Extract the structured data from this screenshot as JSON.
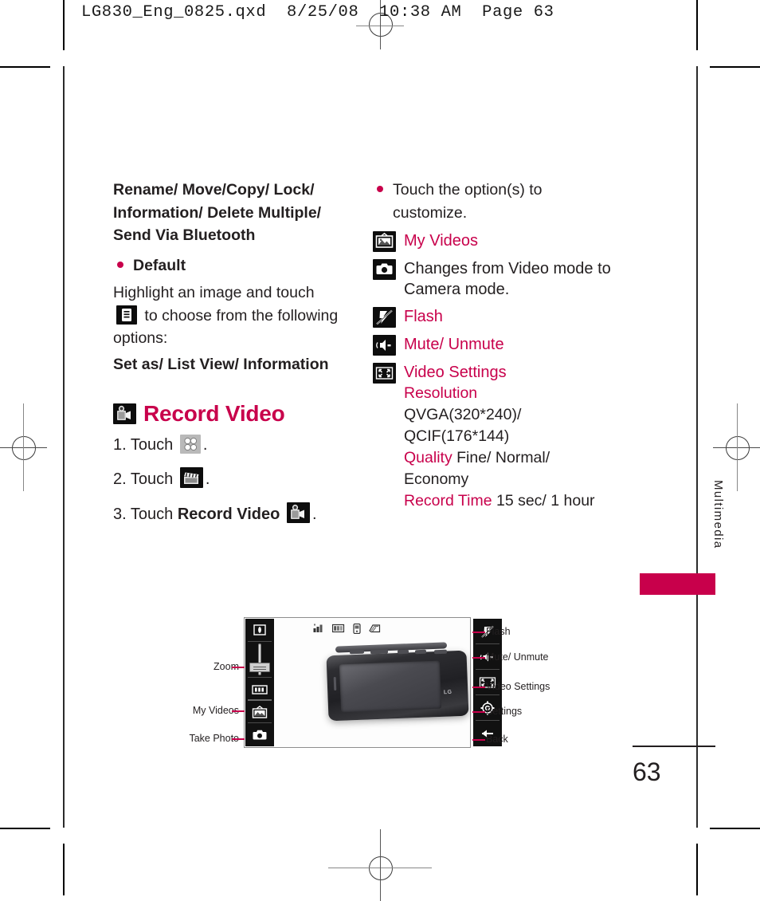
{
  "page": {
    "slug": "LG830_Eng_0825.qxd  8/25/08  10:38 AM  Page 63",
    "folio": "63",
    "section_tab": "Multimedia",
    "accent_color": "#c8004b"
  },
  "left_column": {
    "options_list": "Rename/ Move/Copy/ Lock/ Information/ Delete Multiple/ Send Via Bluetooth",
    "default_bullet": "Default",
    "instruction_part1": "Highlight an image and touch",
    "instruction_part2": "to choose from the following options:",
    "options_result": "Set as/ List View/ Information",
    "heading": "Record Video",
    "steps": [
      {
        "number": "1. Touch",
        "icon": "grid-icon",
        "suffix": "."
      },
      {
        "number": "2. Touch",
        "icon": "clapperboard-icon",
        "suffix": "."
      },
      {
        "number": "3. Touch",
        "bold": "Record Video",
        "icon": "camcorder-icon",
        "suffix": "."
      }
    ]
  },
  "right_column": {
    "bullet": "Touch the option(s) to customize.",
    "options": [
      {
        "icon": "my-videos-icon",
        "label": "My Videos",
        "color": "magenta"
      },
      {
        "icon": "camera-icon",
        "label": "Changes from Video mode to Camera mode.",
        "color": "black"
      },
      {
        "icon": "flash-icon",
        "label": "Flash",
        "color": "magenta"
      },
      {
        "icon": "mute-icon",
        "label": "Mute/ Unmute",
        "color": "magenta"
      },
      {
        "icon": "video-settings-icon",
        "label": "Video Settings",
        "color": "magenta"
      }
    ],
    "video_settings": {
      "resolution_label": "Resolution",
      "resolution_values": "QVGA(320*240)/ QCIF(176*144)",
      "quality_label": "Quality",
      "quality_values": "Fine/ Normal/ Economy",
      "record_time_label": "Record Time",
      "record_time_values": "15 sec/ 1 hour"
    }
  },
  "figure": {
    "left_callouts": [
      {
        "label": "Zoom",
        "icon": "zoom-slider-icon"
      },
      {
        "label": "My Videos",
        "icon": "my-videos-icon"
      },
      {
        "label": "Take Photo",
        "icon": "camera-icon"
      }
    ],
    "right_callouts": [
      {
        "label": "Flash",
        "icon": "flash-icon"
      },
      {
        "label": "Mute/ Unmute",
        "icon": "mute-icon"
      },
      {
        "label": "Video Settings",
        "icon": "video-settings-icon"
      },
      {
        "label": "Settings",
        "icon": "gear-icon"
      },
      {
        "label": "Back",
        "icon": "back-arrow-icon"
      }
    ],
    "status_icons": [
      "signal-icon",
      "battery-icon",
      "phone-icon",
      "mode-icon"
    ],
    "top_buttons": [
      "brightness-icon",
      "white-balance-icon"
    ],
    "device_brand": "LG"
  }
}
